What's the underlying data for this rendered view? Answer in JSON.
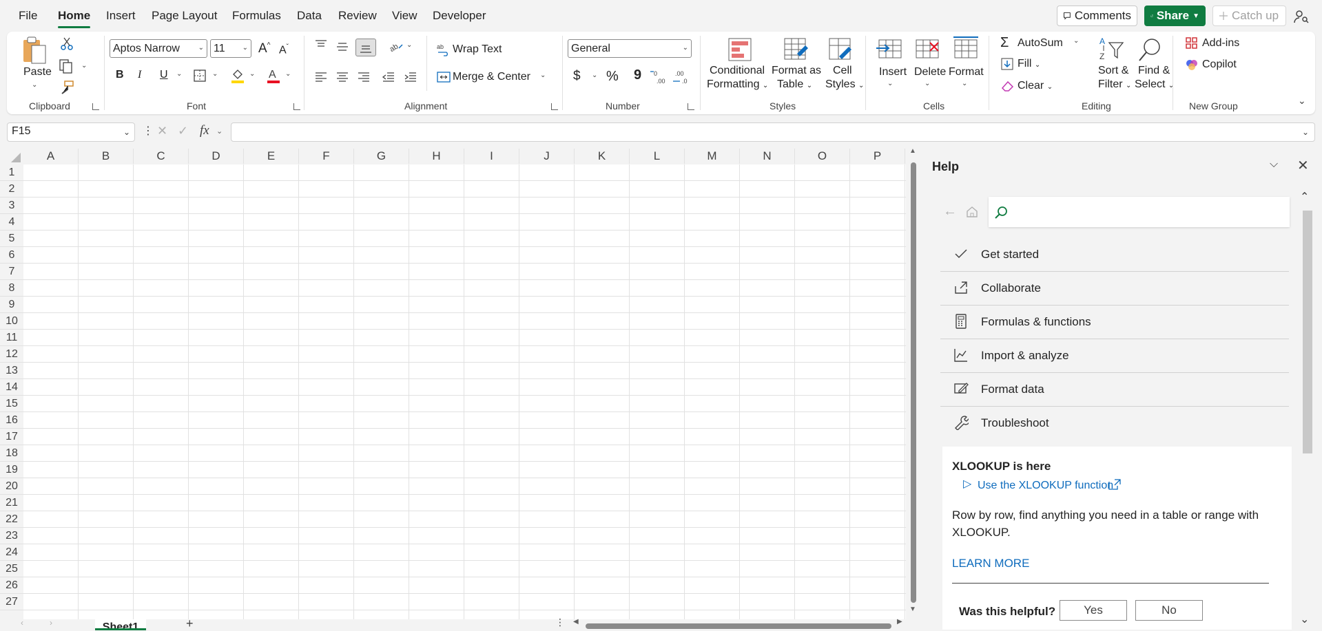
{
  "menu": {
    "tabs": [
      "File",
      "Home",
      "Insert",
      "Page Layout",
      "Formulas",
      "Data",
      "Review",
      "View",
      "Developer"
    ],
    "active_tab": "Home",
    "comments_label": "Comments",
    "share_label": "Share",
    "catch_up_label": "Catch up"
  },
  "ribbon": {
    "clipboard": {
      "group_label": "Clipboard",
      "paste_label": "Paste"
    },
    "font": {
      "group_label": "Font",
      "font_name": "Aptos Narrow",
      "font_size": "11",
      "bold": "B",
      "italic": "I",
      "underline": "U",
      "grow": "A",
      "shrink": "A"
    },
    "alignment": {
      "group_label": "Alignment",
      "wrap_text_label": "Wrap Text",
      "merge_center_label": "Merge & Center"
    },
    "number": {
      "group_label": "Number",
      "format_value": "General",
      "currency": "$",
      "percent": "%",
      "comma": "9"
    },
    "styles": {
      "group_label": "Styles",
      "conditional_line1": "Conditional",
      "conditional_line2": "Formatting",
      "format_table_line1": "Format as",
      "format_table_line2": "Table",
      "cell_styles_line1": "Cell",
      "cell_styles_line2": "Styles"
    },
    "cells": {
      "group_label": "Cells",
      "insert_label": "Insert",
      "delete_label": "Delete",
      "format_label": "Format"
    },
    "editing": {
      "group_label": "Editing",
      "autosum_label": "AutoSum",
      "fill_label": "Fill",
      "clear_label": "Clear",
      "sort_line1": "Sort &",
      "sort_line2": "Filter",
      "find_line1": "Find &",
      "find_line2": "Select"
    },
    "new_group": {
      "group_label": "New Group",
      "addins_label": "Add-ins",
      "copilot_label": "Copilot"
    }
  },
  "formula_bar": {
    "name_box_value": "F15",
    "fx_label": "fx",
    "formula_value": ""
  },
  "sheet": {
    "columns": [
      "A",
      "B",
      "C",
      "D",
      "E",
      "F",
      "G",
      "H",
      "I",
      "J",
      "K",
      "L",
      "M",
      "N",
      "O",
      "P"
    ],
    "rows": [
      "1",
      "2",
      "3",
      "4",
      "5",
      "6",
      "7",
      "8",
      "9",
      "10",
      "11",
      "12",
      "13",
      "14",
      "15",
      "16",
      "17",
      "18",
      "19",
      "20",
      "21",
      "22",
      "23",
      "24",
      "25",
      "26",
      "27"
    ],
    "active_sheet_tab": "Sheet1",
    "add_sheet": "+"
  },
  "help_pane": {
    "title": "Help",
    "search_placeholder": "",
    "items": [
      {
        "label": "Get started",
        "icon": "check-icon"
      },
      {
        "label": "Collaborate",
        "icon": "share-icon"
      },
      {
        "label": "Formulas & functions",
        "icon": "calculator-icon"
      },
      {
        "label": "Import & analyze",
        "icon": "chart-icon"
      },
      {
        "label": "Format data",
        "icon": "format-icon"
      },
      {
        "label": "Troubleshoot",
        "icon": "wrench-icon"
      }
    ],
    "card": {
      "title": "XLOOKUP is here",
      "link_label": "Use the XLOOKUP function",
      "description": "Row by row, find anything you need in a table or range with XLOOKUP.",
      "learn_more": "LEARN MORE",
      "helpful_question": "Was this helpful?",
      "yes_label": "Yes",
      "no_label": "No"
    }
  },
  "colors": {
    "accent_green": "#107c41",
    "share_green": "#107c41",
    "link_blue": "#0f6cbd",
    "red": "#e81123"
  }
}
